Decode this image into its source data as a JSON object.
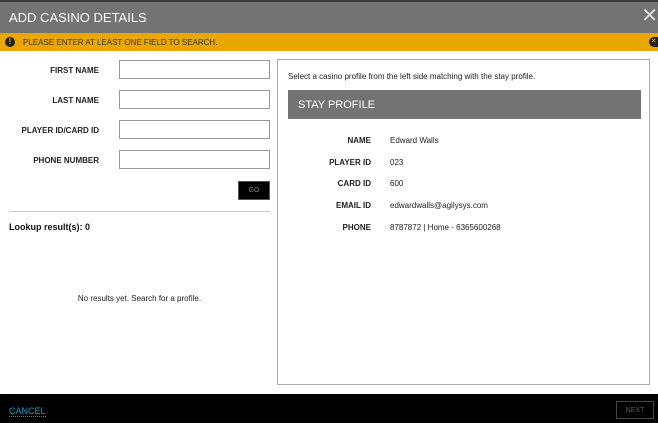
{
  "dialog": {
    "title": "ADD CASINO DETAILS",
    "close_icon": "close-icon"
  },
  "alert": {
    "message": "PLEASE ENTER AT LEAST ONE FIELD TO SEARCH.",
    "icon": "exclamation-icon",
    "bg_color": "#e8a800"
  },
  "search": {
    "first_name_label": "FIRST NAME",
    "first_name_value": "",
    "last_name_label": "LAST NAME",
    "last_name_value": "",
    "player_id_label": "PLAYER ID/CARD ID",
    "player_id_value": "",
    "phone_label": "PHONE NUMBER",
    "phone_value": "",
    "go_label": "GO"
  },
  "results": {
    "lookup_label": "Lookup result(s): 0",
    "empty_text": "No results yet. Search for a profile."
  },
  "stay_profile": {
    "hint": "Select a casino profile from the left side matching with the stay profile.",
    "header": "STAY PROFILE",
    "fields": [
      {
        "label": "NAME",
        "value": "Edward Walls"
      },
      {
        "label": "PLAYER ID",
        "value": "023"
      },
      {
        "label": "CARD ID",
        "value": "600"
      },
      {
        "label": "EMAIL ID",
        "value": "edwardwalls@agilysys.com"
      },
      {
        "label": "PHONE",
        "value": "8787872 | Home - 6365600268"
      }
    ]
  },
  "footer": {
    "cancel_label": "CANCEL",
    "next_label": "NEXT"
  }
}
